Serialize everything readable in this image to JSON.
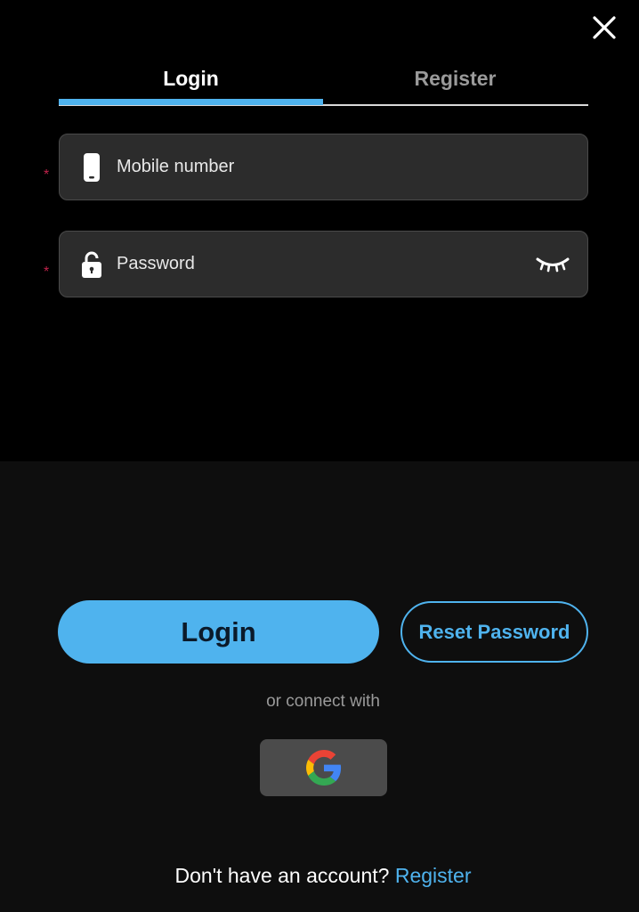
{
  "tabs": {
    "login": "Login",
    "register": "Register",
    "active": "login"
  },
  "form": {
    "required_mark": "*",
    "mobile": {
      "placeholder": "Mobile number",
      "value": ""
    },
    "password": {
      "placeholder": "Password",
      "value": ""
    }
  },
  "actions": {
    "login_label": "Login",
    "reset_label": "Reset Password"
  },
  "social": {
    "or_text": "or connect with",
    "provider_icon": "google-icon"
  },
  "footer": {
    "prompt": "Don't have an account?",
    "link": "Register"
  },
  "icons": {
    "close": "close-icon",
    "mobile": "mobile-phone-icon",
    "lock": "lock-icon",
    "eye": "eye-closed-icon"
  },
  "colors": {
    "accent": "#4fb3ee",
    "background": "#000000",
    "panel": "#0e0e0e",
    "field_bg": "#2c2c2c",
    "required": "#c0234b"
  }
}
